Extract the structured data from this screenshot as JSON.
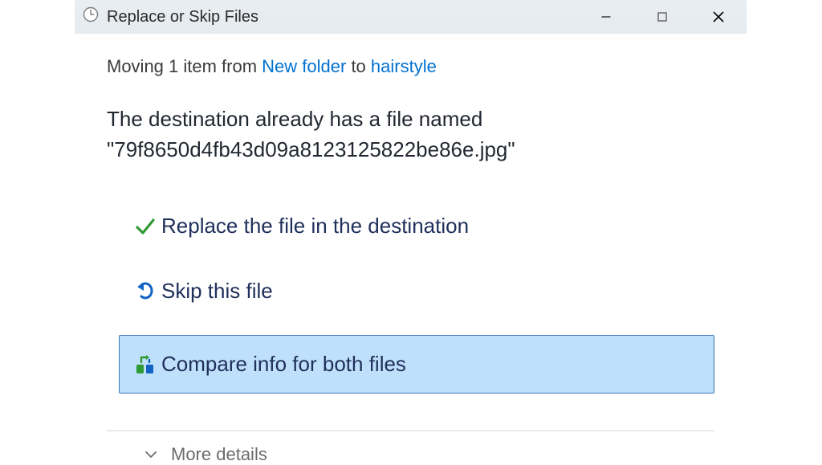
{
  "titlebar": {
    "title": "Replace or Skip Files"
  },
  "moving": {
    "prefix": "Moving 1 item from ",
    "source": "New folder",
    "middle": " to ",
    "destination": "hairstyle"
  },
  "conflict": {
    "line1": "The destination already has a file named",
    "line2": "\"79f8650d4fb43d09a8123125822be86e.jpg\""
  },
  "options": {
    "replace": "Replace the file in the destination",
    "skip": "Skip this file",
    "compare": "Compare info for both files"
  },
  "footer": {
    "more": "More details"
  },
  "colors": {
    "link": "#0071d1",
    "accent_bg": "#bfe0fb",
    "accent_border": "#3a77b5",
    "heading": "#20305b"
  }
}
